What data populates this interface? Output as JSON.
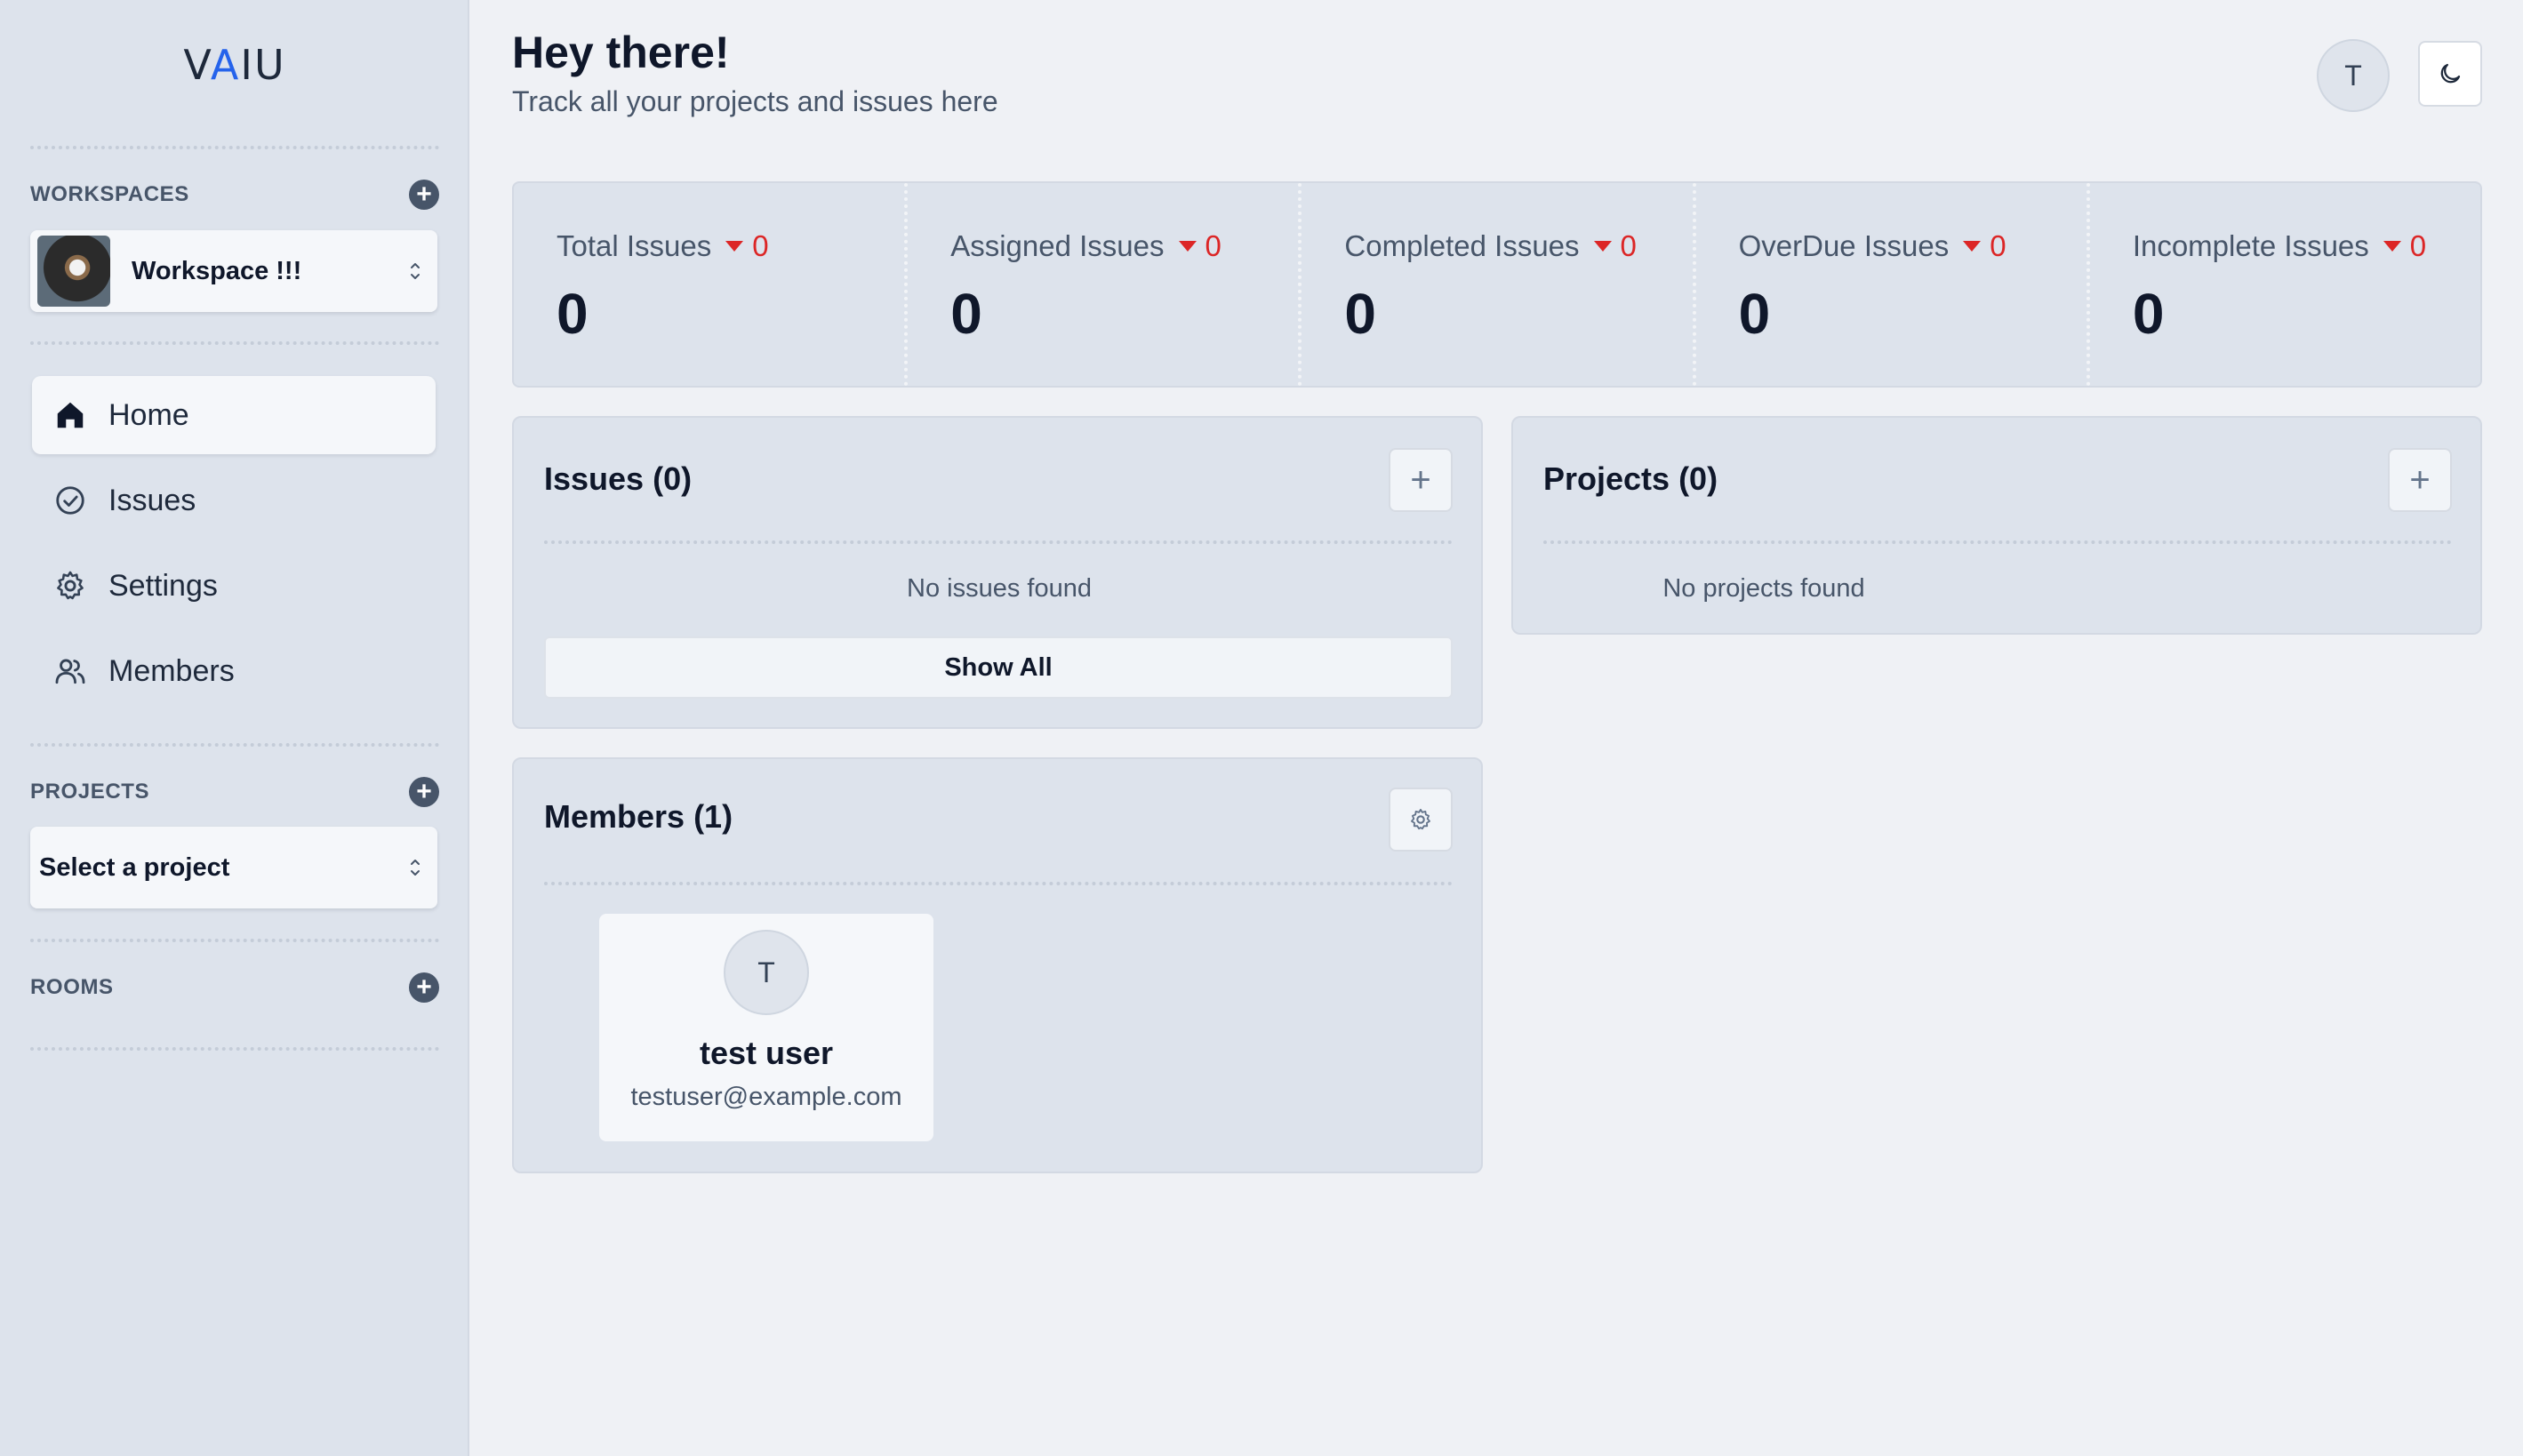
{
  "app": {
    "logo": "VAIU"
  },
  "sidebar": {
    "workspaces_label": "WORKSPACES",
    "workspace_name": "Workspace !!!",
    "nav": [
      {
        "label": "Home",
        "icon": "home-icon"
      },
      {
        "label": "Issues",
        "icon": "check-circle-icon"
      },
      {
        "label": "Settings",
        "icon": "gear-icon"
      },
      {
        "label": "Members",
        "icon": "users-icon"
      }
    ],
    "projects_label": "PROJECTS",
    "project_select_placeholder": "Select a project",
    "rooms_label": "ROOMS"
  },
  "header": {
    "title": "Hey there!",
    "subtitle": "Track all your projects and issues here",
    "user_initial": "T"
  },
  "stats": [
    {
      "title": "Total Issues",
      "delta": "0",
      "value": "0"
    },
    {
      "title": "Assigned Issues",
      "delta": "0",
      "value": "0"
    },
    {
      "title": "Completed Issues",
      "delta": "0",
      "value": "0"
    },
    {
      "title": "OverDue Issues",
      "delta": "0",
      "value": "0"
    },
    {
      "title": "Incomplete Issues",
      "delta": "0",
      "value": "0"
    }
  ],
  "issues_card": {
    "title": "Issues (0)",
    "empty_text": "No issues found",
    "show_all_label": "Show All"
  },
  "projects_card": {
    "title": "Projects (0)",
    "empty_text": "No projects found"
  },
  "members_card": {
    "title": "Members (1)",
    "members": [
      {
        "initial": "T",
        "name": "test user",
        "email": "testuser@example.com"
      }
    ]
  },
  "colors": {
    "accent": "#2563eb",
    "negative": "#dc2626",
    "sidebar_bg": "#dde3ec",
    "page_bg": "#eff1f5"
  }
}
